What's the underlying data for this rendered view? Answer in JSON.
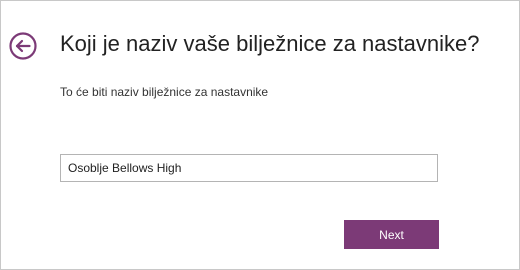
{
  "dialog": {
    "title": "Koji je naziv vaše bilježnice za nastavnike?",
    "subtitle": "To će biti naziv bilježnice za nastavnike",
    "notebook_name_value": "Osoblje Bellows High",
    "next_label": "Next",
    "back_icon": "back-arrow-circle-icon",
    "accent_color": "#7c3a77"
  }
}
